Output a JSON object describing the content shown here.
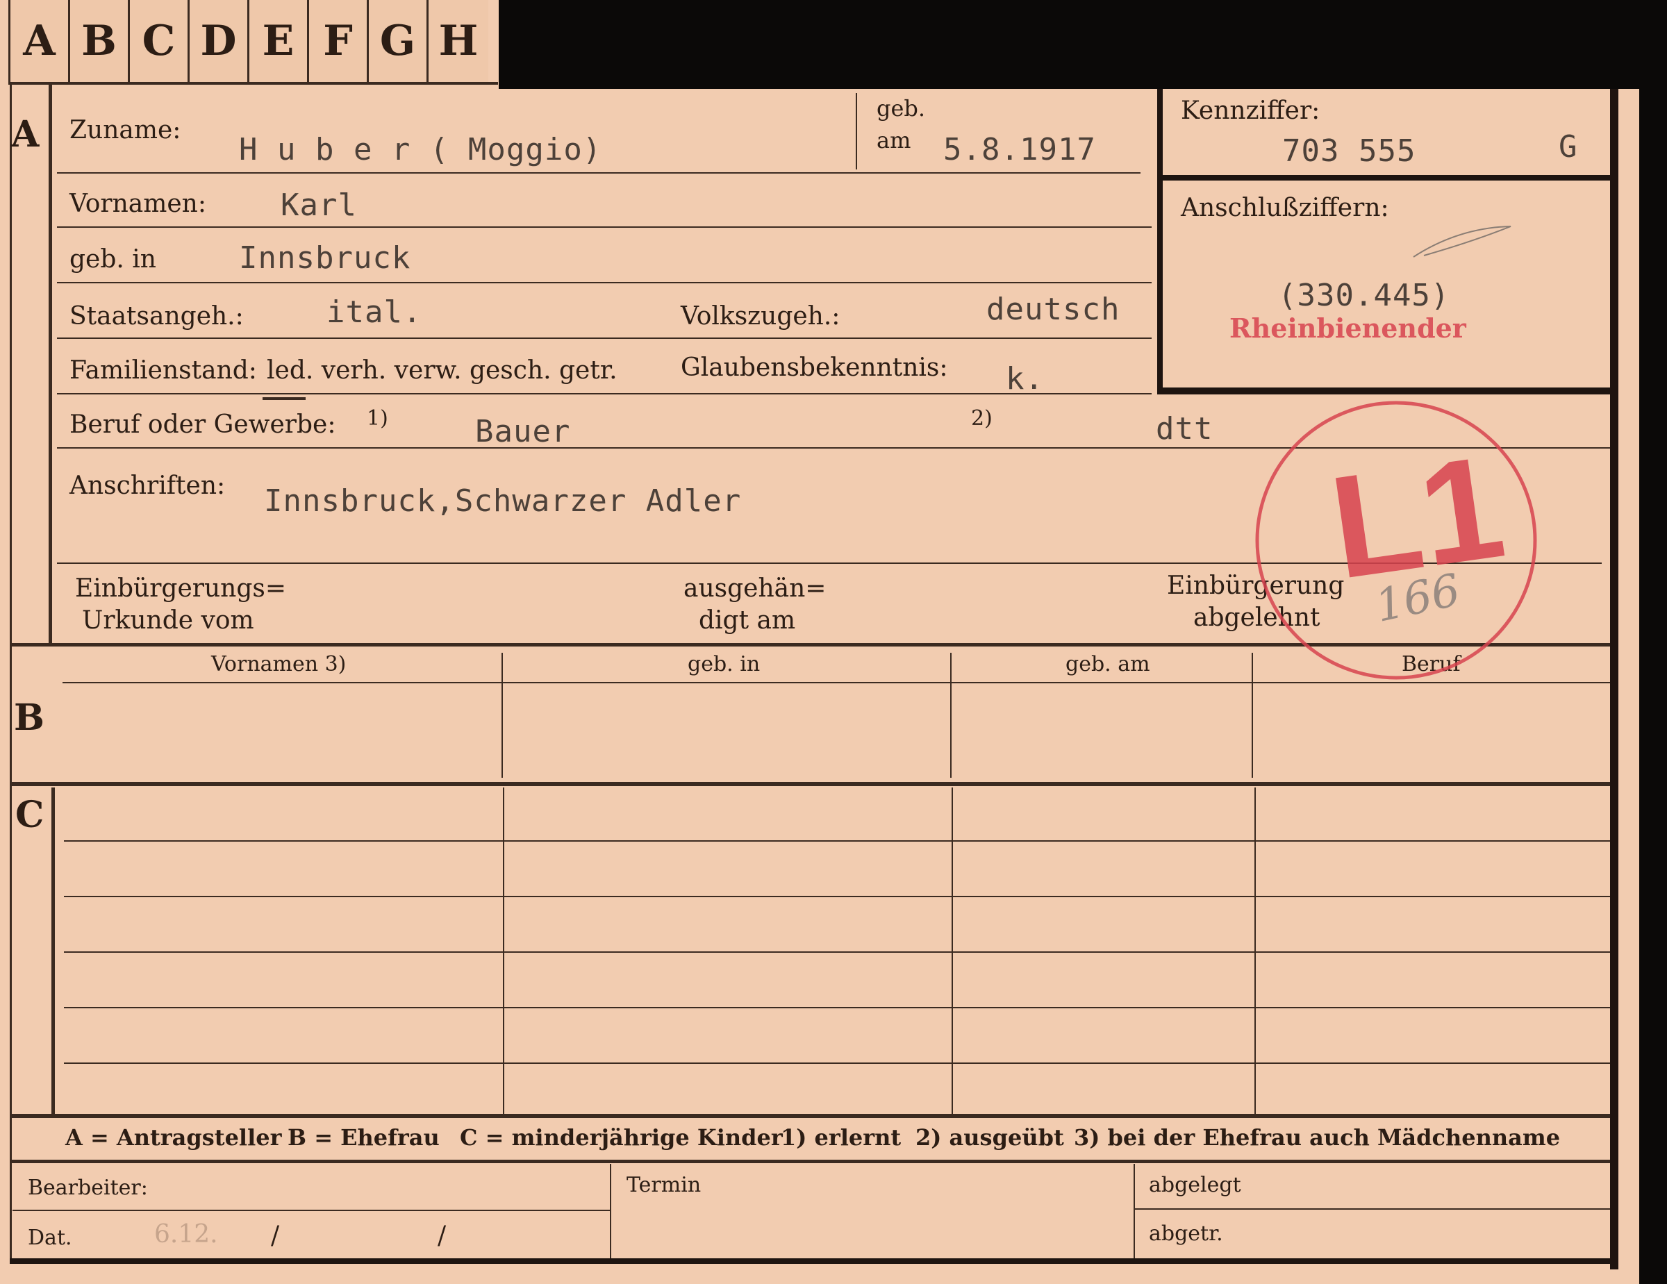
{
  "tabs": [
    "A",
    "B",
    "C",
    "D",
    "E",
    "F",
    "G",
    "H"
  ],
  "sections": {
    "a": "A",
    "b": "B",
    "c": "C"
  },
  "labels": {
    "zuname": "Zuname:",
    "geb": "geb.",
    "am": "am",
    "kennziffer": "Kennziffer:",
    "vornamen": "Vornamen:",
    "anschlussziffern": "Anschlußziffern:",
    "geb_in": "geb. in",
    "staatsangeh": "Staatsangeh.:",
    "volkszugeh": "Volkszugeh.:",
    "familienstand": "Familienstand:",
    "familienstand_options": "led. verh. verw. gesch. getr.",
    "glaubensbekenntnis": "Glaubensbekenntnis:",
    "beruf": "Beruf oder Gewerbe:",
    "beruf_note1": "1)",
    "beruf_note2": "2)",
    "anschriften": "Anschriften:",
    "einbuergerung_1": "Einbürgerungs=",
    "einbuergerung_2": "Urkunde vom",
    "ausgehaendigt_1": "ausgehän=",
    "ausgehaendigt_2": "digt am",
    "abgelehnt_1": "Einbürgerung",
    "abgelehnt_2": "abgelehnt"
  },
  "values": {
    "zuname": "H u b e r ( Moggio)",
    "geb_am": "5.8.1917",
    "kennziffer": "703 555",
    "kennziffer_suffix": "G",
    "vornamen": "Karl",
    "geb_in": "Innsbruck",
    "anschluss": "(330.445)",
    "staatsangeh": "ital.",
    "volkszugeh": "deutsch",
    "glaubensbekenntnis": "k.",
    "beruf_erlernt": "Bauer",
    "beruf_ausgeuebt": "dtt",
    "anschrift": "Innsbruck,Schwarzer Adler"
  },
  "table_b": {
    "headers": [
      "Vornamen 3)",
      "geb. in",
      "geb. am",
      "Beruf"
    ]
  },
  "footnote": {
    "a": "A = Antragsteller",
    "b": "B = Ehefrau",
    "c": "C = minderjährige Kinder",
    "n1": "1) erlernt",
    "n2": "2) ausgeübt",
    "n3": "3) bei der Ehefrau auch Mädchenname"
  },
  "bottom": {
    "bearbeiter": "Bearbeiter:",
    "termin": "Termin",
    "abgelegt": "abgelegt",
    "dat": "Dat.",
    "dat_day": "6.12.",
    "dat_slash1": "/",
    "dat_slash2": "/",
    "abgetr": "abgetr."
  },
  "stamps": {
    "circle_text": "L1",
    "circle_note": "166",
    "red_mark": "Rheinbienender"
  },
  "colors": {
    "card": "#f2ccb0",
    "ink": "#3b2a20",
    "stamp": "#d7434f",
    "typewriter": "#4d4139"
  }
}
